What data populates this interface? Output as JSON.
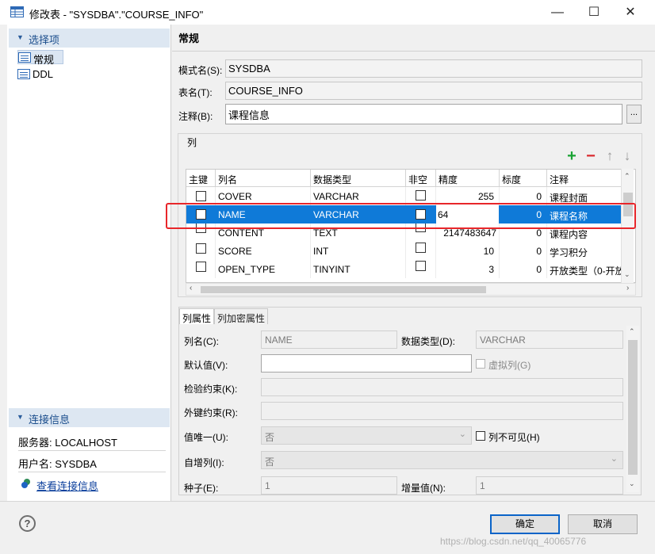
{
  "window": {
    "title": "修改表 - \"SYSDBA\".\"COURSE_INFO\"",
    "minimize": "—",
    "maximize": "☐",
    "close": "✕"
  },
  "sidebar": {
    "selection_header": "选择项",
    "items": [
      {
        "label": "常规",
        "icon": "table-icon"
      },
      {
        "label": "DDL",
        "icon": "table-icon"
      }
    ],
    "connection_header": "连接信息",
    "server": "服务器: LOCALHOST",
    "user": "用户名: SYSDBA",
    "view_connection": "查看连接信息"
  },
  "general": {
    "title": "常规",
    "schema_label": "模式名(S):",
    "schema_value": "SYSDBA",
    "table_label": "表名(T):",
    "table_value": "COURSE_INFO",
    "comment_label": "注释(B):",
    "comment_value": "课程信息",
    "comment_button": "..."
  },
  "columns": {
    "group_title": "列",
    "toolbar": {
      "add": "+",
      "remove": "−",
      "up": "↑",
      "down": "↓"
    },
    "headers": [
      "主键",
      "列名",
      "数据类型",
      "非空",
      "精度",
      "标度",
      "注释"
    ],
    "rows": [
      {
        "pk": false,
        "name": "COVER",
        "type": "VARCHAR",
        "notnull": false,
        "precision": "255",
        "scale": "0",
        "comment": "课程封面"
      },
      {
        "pk": false,
        "name": "NAME",
        "type": "VARCHAR",
        "notnull": false,
        "precision": "64",
        "scale": "0",
        "comment": "课程名称",
        "selected": true
      },
      {
        "pk": false,
        "name": "CONTENT",
        "type": "TEXT",
        "notnull": false,
        "precision": "2147483647",
        "scale": "0",
        "comment": "课程内容"
      },
      {
        "pk": false,
        "name": "SCORE",
        "type": "INT",
        "notnull": false,
        "precision": "10",
        "scale": "0",
        "comment": "学习积分"
      },
      {
        "pk": false,
        "name": "OPEN_TYPE",
        "type": "TINYINT",
        "notnull": false,
        "precision": "3",
        "scale": "0",
        "comment": "开放类型（0-开放"
      }
    ]
  },
  "attributes": {
    "tabs": [
      "列属性",
      "列加密属性"
    ],
    "col_name_label": "列名(C):",
    "col_name_value": "NAME",
    "data_type_label": "数据类型(D):",
    "data_type_value": "VARCHAR",
    "default_label": "默认值(V):",
    "default_value": "",
    "virtual_label": "虚拟列(G)",
    "check_label": "检验约束(K):",
    "fk_label": "外键约束(R):",
    "unique_label": "值唯一(U):",
    "unique_value": "否",
    "invisible_label": "列不可见(H)",
    "identity_label": "自增列(I):",
    "identity_value": "否",
    "seed_label": "种子(E):",
    "seed_value": "1",
    "increment_label": "增量值(N):",
    "increment_value": "1"
  },
  "footer": {
    "help": "?",
    "ok": "确定",
    "cancel": "取消",
    "watermark": "https://blog.csdn.net/qq_40065776"
  },
  "colors": {
    "selection": "#0f7ad8",
    "highlight_box": "#e8262a",
    "add": "#1aa334",
    "remove": "#d9272c"
  }
}
